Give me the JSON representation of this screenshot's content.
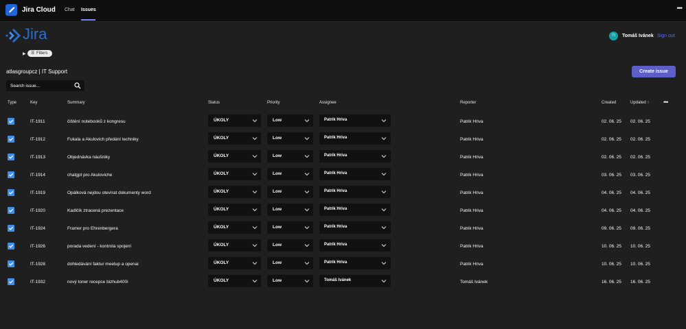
{
  "app": {
    "name": "Jira Cloud",
    "tabs": [
      {
        "label": "Chat"
      },
      {
        "label": "Issues"
      }
    ],
    "active_tab": "Issues",
    "accent": "#7f85f5"
  },
  "header": {
    "logo_text": "Jira",
    "user": {
      "name": "Tomáš Ivánek",
      "initials": "TI"
    },
    "sign_out": "Sign out"
  },
  "filters": {
    "label": "Filters"
  },
  "project": {
    "title": "atlasgroupcz | IT Support"
  },
  "create_button": "Create issue",
  "search": {
    "placeholder": "Search issue..."
  },
  "columns": {
    "type": "Type",
    "key": "Key",
    "summary": "Summary",
    "status": "Status",
    "priority": "Priority",
    "assignee": "Assignee",
    "reporter": "Reporter",
    "created": "Created",
    "updated": "Updated ↑"
  },
  "issues": [
    {
      "key": "IT-1911",
      "summary": "čištění notebooků z kongresu",
      "status": "ÚKOLY",
      "priority": "Low",
      "assignee": "Patrik Hriva",
      "reporter": "Patrik Hriva",
      "created": "02. 06. 25",
      "updated": "02. 06. 25"
    },
    {
      "key": "IT-1912",
      "summary": "Fukala a Akulovich předání techniky",
      "status": "ÚKOLY",
      "priority": "Low",
      "assignee": "Patrik Hriva",
      "reporter": "Patrik Hriva",
      "created": "02. 06. 25",
      "updated": "02. 06. 25"
    },
    {
      "key": "IT-1913",
      "summary": "Objednávka náušniky",
      "status": "ÚKOLY",
      "priority": "Low",
      "assignee": "Patrik Hriva",
      "reporter": "Patrik Hriva",
      "created": "02. 06. 25",
      "updated": "02. 06. 25"
    },
    {
      "key": "IT-1914",
      "summary": "chatgpt pro Akuloviche",
      "status": "ÚKOLY",
      "priority": "Low",
      "assignee": "Patrik Hriva",
      "reporter": "Patrik Hriva",
      "created": "03. 06. 25",
      "updated": "03. 06. 25"
    },
    {
      "key": "IT-1919",
      "summary": "Opálková nejdou otevírat dokumenty word",
      "status": "ÚKOLY",
      "priority": "Low",
      "assignee": "Patrik Hriva",
      "reporter": "Patrik Hriva",
      "created": "04. 06. 25",
      "updated": "04. 06. 25"
    },
    {
      "key": "IT-1920",
      "summary": "Kadlčík ztracená prezentace",
      "status": "ÚKOLY",
      "priority": "Low",
      "assignee": "Patrik Hriva",
      "reporter": "Patrik Hriva",
      "created": "04. 06. 25",
      "updated": "04. 06. 25"
    },
    {
      "key": "IT-1924",
      "summary": "Framer pro Ehrenbergera",
      "status": "ÚKOLY",
      "priority": "Low",
      "assignee": "Patrik Hriva",
      "reporter": "Patrik Hriva",
      "created": "09. 06. 25",
      "updated": "09. 06. 25"
    },
    {
      "key": "IT-1926",
      "summary": "porada vedení - kontrola spojení",
      "status": "ÚKOLY",
      "priority": "Low",
      "assignee": "Patrik Hriva",
      "reporter": "Patrik Hriva",
      "created": "10. 06. 25",
      "updated": "10. 06. 25"
    },
    {
      "key": "IT-1928",
      "summary": "dohledávání faktur meetup a openai",
      "status": "ÚKOLY",
      "priority": "Low",
      "assignee": "Patrik Hriva",
      "reporter": "Patrik Hriva",
      "created": "10. 06. 25",
      "updated": "10. 06. 25"
    },
    {
      "key": "IT-1932",
      "summary": "nový toner recepce bizhub400i",
      "status": "ÚKOLY",
      "priority": "Low",
      "assignee": "Tomáš Ivánek",
      "reporter": "Tomáš Ivánek",
      "created": "16. 06. 25",
      "updated": "16. 06. 25"
    }
  ],
  "colors": {
    "brand": "#2b6fd0",
    "button": "#5b5fc7",
    "link": "#5a6bff",
    "checkbox": "#3f8ee8",
    "background": "#1f1f1f"
  }
}
